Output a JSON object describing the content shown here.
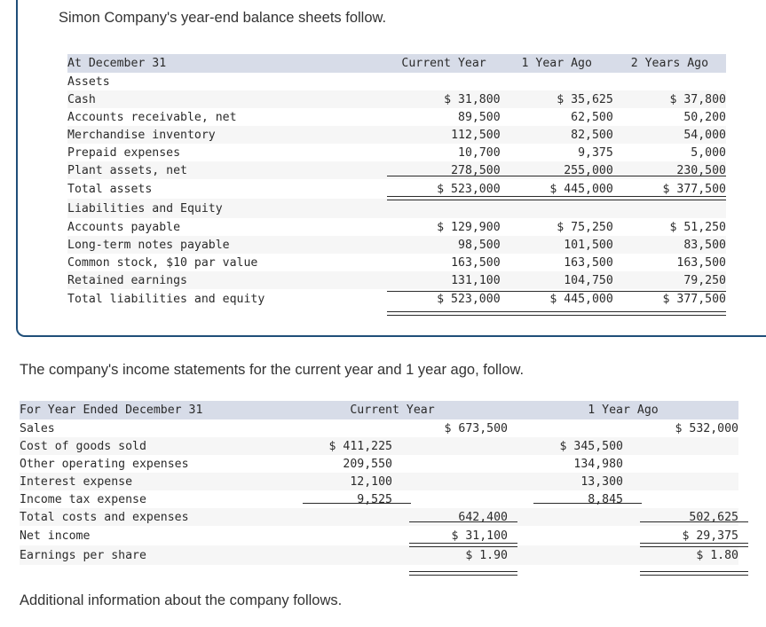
{
  "intro_balance_sheet": "Simon Company's year-end balance sheets follow.",
  "intro_income_statement": "The company's income statements for the current year and 1 year ago, follow.",
  "outro": "Additional information about the company follows.",
  "balance_sheet": {
    "header": {
      "label": "At December 31",
      "col1": "Current Year",
      "col2": "1 Year Ago",
      "col3": "2 Years Ago"
    },
    "section_assets": "Assets",
    "asset_rows": [
      {
        "label": "Cash",
        "c1": "$ 31,800",
        "c2": "$ 35,625",
        "c3": "$ 37,800"
      },
      {
        "label": "Accounts receivable, net",
        "c1": "89,500",
        "c2": "62,500",
        "c3": "50,200"
      },
      {
        "label": "Merchandise inventory",
        "c1": "112,500",
        "c2": "82,500",
        "c3": "54,000"
      },
      {
        "label": "Prepaid expenses",
        "c1": "10,700",
        "c2": "9,375",
        "c3": "5,000"
      },
      {
        "label": "Plant assets, net",
        "c1": "278,500",
        "c2": "255,000",
        "c3": "230,500"
      }
    ],
    "total_assets": {
      "label": "Total assets",
      "c1": "$ 523,000",
      "c2": "$ 445,000",
      "c3": "$ 377,500"
    },
    "section_liabilities": "Liabilities and Equity",
    "liability_rows": [
      {
        "label": "Accounts payable",
        "c1": "$ 129,900",
        "c2": "$ 75,250",
        "c3": "$ 51,250"
      },
      {
        "label": "Long-term notes payable",
        "c1": "98,500",
        "c2": "101,500",
        "c3": "83,500"
      },
      {
        "label": "Common stock, $10 par value",
        "c1": "163,500",
        "c2": "163,500",
        "c3": "163,500"
      },
      {
        "label": "Retained earnings",
        "c1": "131,100",
        "c2": "104,750",
        "c3": "79,250"
      }
    ],
    "total_liabilities": {
      "label": "Total liabilities and equity",
      "c1": "$ 523,000",
      "c2": "$ 445,000",
      "c3": "$ 377,500"
    }
  },
  "income_statement": {
    "header": {
      "label": "For Year Ended December 31",
      "col1": "Current Year",
      "col2": "1 Year Ago"
    },
    "rows": [
      {
        "label": "Sales",
        "cur_det": "",
        "cur_tot": "$ 673,500",
        "ago_det": "",
        "ago_tot": "$ 532,000"
      },
      {
        "label": "Cost of goods sold",
        "cur_det": "$ 411,225",
        "cur_tot": "",
        "ago_det": "$ 345,500",
        "ago_tot": ""
      },
      {
        "label": "Other operating expenses",
        "cur_det": "209,550",
        "cur_tot": "",
        "ago_det": "134,980",
        "ago_tot": ""
      },
      {
        "label": "Interest expense",
        "cur_det": "12,100",
        "cur_tot": "",
        "ago_det": "13,300",
        "ago_tot": ""
      },
      {
        "label": "Income tax expense",
        "cur_det": "9,525",
        "cur_tot": "",
        "ago_det": "8,845",
        "ago_tot": ""
      },
      {
        "label": "Total costs and expenses",
        "cur_det": "",
        "cur_tot": "642,400",
        "ago_det": "",
        "ago_tot": "502,625"
      },
      {
        "label": "Net income",
        "cur_det": "",
        "cur_tot": "$ 31,100",
        "ago_det": "",
        "ago_tot": "$ 29,375"
      },
      {
        "label": "Earnings per share",
        "cur_det": "",
        "cur_tot": "$ 1.90",
        "ago_det": "",
        "ago_tot": "$ 1.80"
      }
    ]
  },
  "colors": {
    "panel_border": "#1f4e79",
    "table_header_bg": "#d7dce8",
    "stripe_bg": "#f6f6f6",
    "text": "#2b2b2b"
  }
}
